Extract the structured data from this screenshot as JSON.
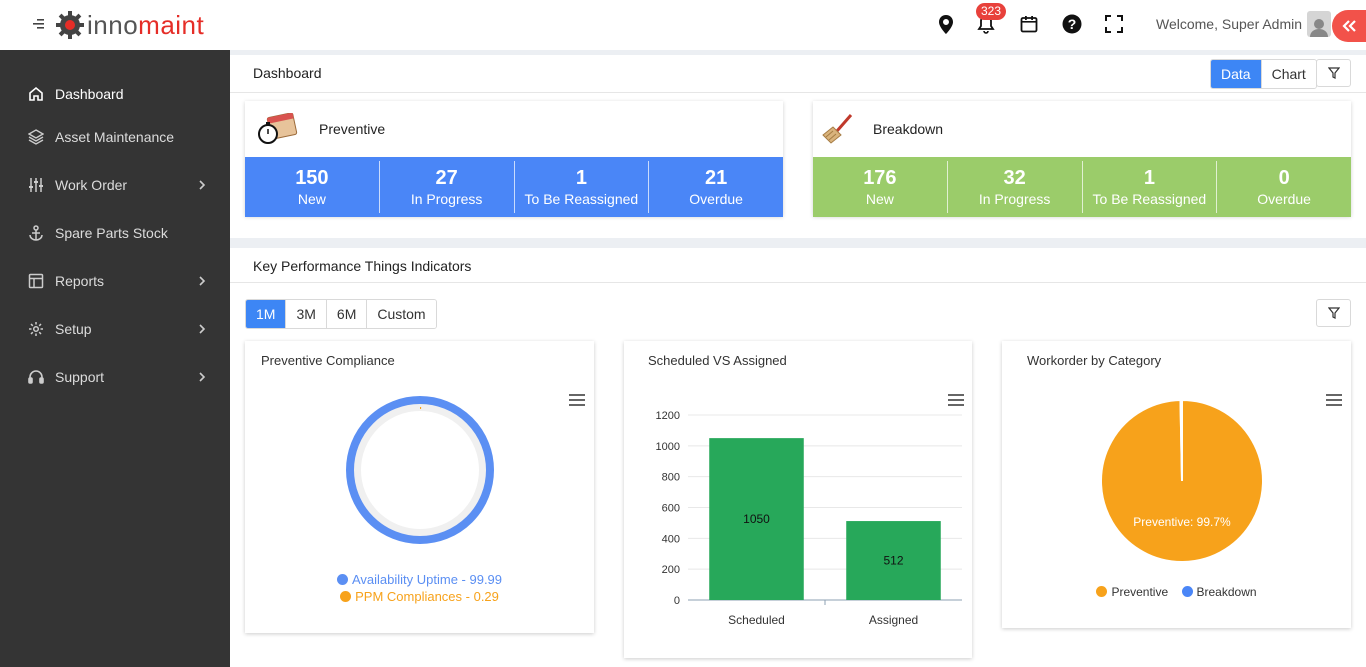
{
  "app": {
    "brand_part1": "inno",
    "brand_part2": "maint"
  },
  "header": {
    "notification_count": "323",
    "welcome": "Welcome, Super Admin",
    "icons": [
      "location-icon",
      "bell-icon",
      "calendar-icon",
      "help-icon",
      "fullscreen-icon",
      "user-avatar-icon",
      "collapse-icon"
    ]
  },
  "sidebar": {
    "items": [
      {
        "label": "Dashboard",
        "icon": "home-icon",
        "active": true
      },
      {
        "label": "Asset Maintenance",
        "icon": "layers-icon"
      },
      {
        "label": "Work Order",
        "icon": "sliders-icon",
        "has_children": true
      },
      {
        "label": "Spare Parts Stock",
        "icon": "anchor-icon"
      },
      {
        "label": "Reports",
        "icon": "layout-icon",
        "has_children": true
      },
      {
        "label": "Setup",
        "icon": "gear-icon",
        "has_children": true
      },
      {
        "label": "Support",
        "icon": "headset-icon",
        "has_children": true
      }
    ]
  },
  "dashboard": {
    "title": "Dashboard",
    "view_toggle": {
      "data": "Data",
      "chart": "Chart",
      "selected": "Data"
    },
    "preventive": {
      "title": "Preventive",
      "color": "#4a86f7",
      "stats": [
        {
          "value": "150",
          "label": "New"
        },
        {
          "value": "27",
          "label": "In Progress"
        },
        {
          "value": "1",
          "label": "To Be Reassigned"
        },
        {
          "value": "21",
          "label": "Overdue"
        }
      ]
    },
    "breakdown": {
      "title": "Breakdown",
      "color": "#9bcc6a",
      "stats": [
        {
          "value": "176",
          "label": "New"
        },
        {
          "value": "32",
          "label": "In Progress"
        },
        {
          "value": "1",
          "label": "To Be Reassigned"
        },
        {
          "value": "0",
          "label": "Overdue"
        }
      ]
    }
  },
  "kpi": {
    "title": "Key Performance Things Indicators",
    "ranges": [
      "1M",
      "3M",
      "6M",
      "Custom"
    ],
    "selected_range": "1M"
  },
  "chart_data": [
    {
      "type": "radial",
      "title": "Preventive Compliance",
      "series": [
        {
          "name": "Availability Uptime",
          "value": 99.99,
          "color": "#5b8ff3"
        },
        {
          "name": "PPM Compliances",
          "value": 0.29,
          "color": "#f7a21b"
        }
      ],
      "legend": [
        "Availability Uptime - 99.99",
        "PPM Compliances - 0.29"
      ]
    },
    {
      "type": "bar",
      "title": "Scheduled VS Assigned",
      "categories": [
        "Scheduled",
        "Assigned"
      ],
      "values": [
        1050,
        512
      ],
      "ylim": [
        0,
        1200
      ],
      "yticks": [
        "0",
        "200",
        "400",
        "600",
        "800",
        "1000",
        "1200"
      ],
      "color": "#27a85a",
      "grid": true
    },
    {
      "type": "pie",
      "title": "Workorder by Category",
      "slices": [
        {
          "name": "Preventive",
          "value": 99.7,
          "color": "#f7a21b"
        },
        {
          "name": "Breakdown",
          "value": 0.3,
          "color": "#4a86f7"
        }
      ],
      "slice_label": "Preventive: 99.7%",
      "legend_position": "bottom"
    }
  ]
}
